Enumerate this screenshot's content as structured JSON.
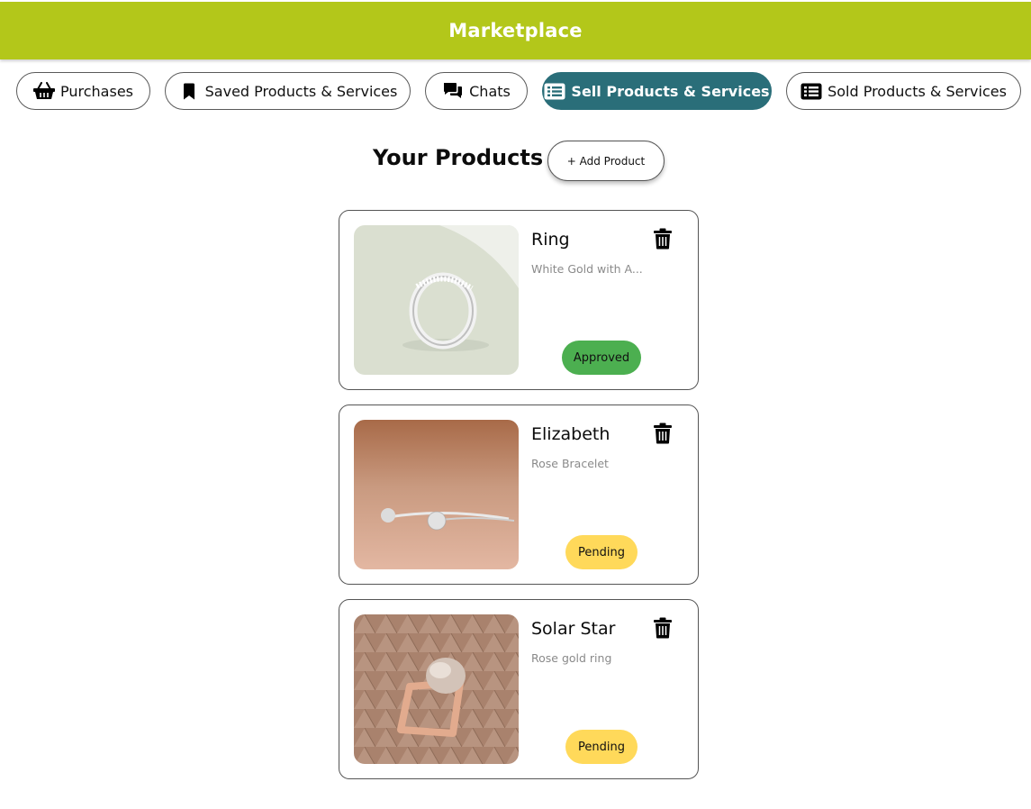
{
  "header": {
    "title": "Marketplace",
    "color": "#b3c71a"
  },
  "tabs": [
    {
      "label": "Purchases",
      "icon": "basket-icon",
      "active": false
    },
    {
      "label": "Saved Products & Services",
      "icon": "bookmark-icon",
      "active": false
    },
    {
      "label": "Chats",
      "icon": "chat-icon",
      "active": false
    },
    {
      "label": "Sell Products & Services",
      "icon": "list-icon",
      "active": true
    },
    {
      "label": "Sold Products & Services",
      "icon": "list-icon",
      "active": false
    }
  ],
  "main": {
    "heading": "Your Products",
    "add_button": "+ Add Product"
  },
  "products": [
    {
      "name": "Ring",
      "description": "White Gold with A...",
      "status": "Approved",
      "status_color": "#4caf50",
      "image": "silver-ring-image"
    },
    {
      "name": "Elizabeth",
      "description": "Rose Bracelet",
      "status": "Pending",
      "status_color": "#ffd95a",
      "image": "silver-bracelet-image"
    },
    {
      "name": "Solar Star",
      "description": "Rose gold ring",
      "status": "Pending",
      "status_color": "#ffd95a",
      "image": "rose-gold-ring-image"
    }
  ],
  "colors": {
    "active_tab": "#2a6e79"
  }
}
